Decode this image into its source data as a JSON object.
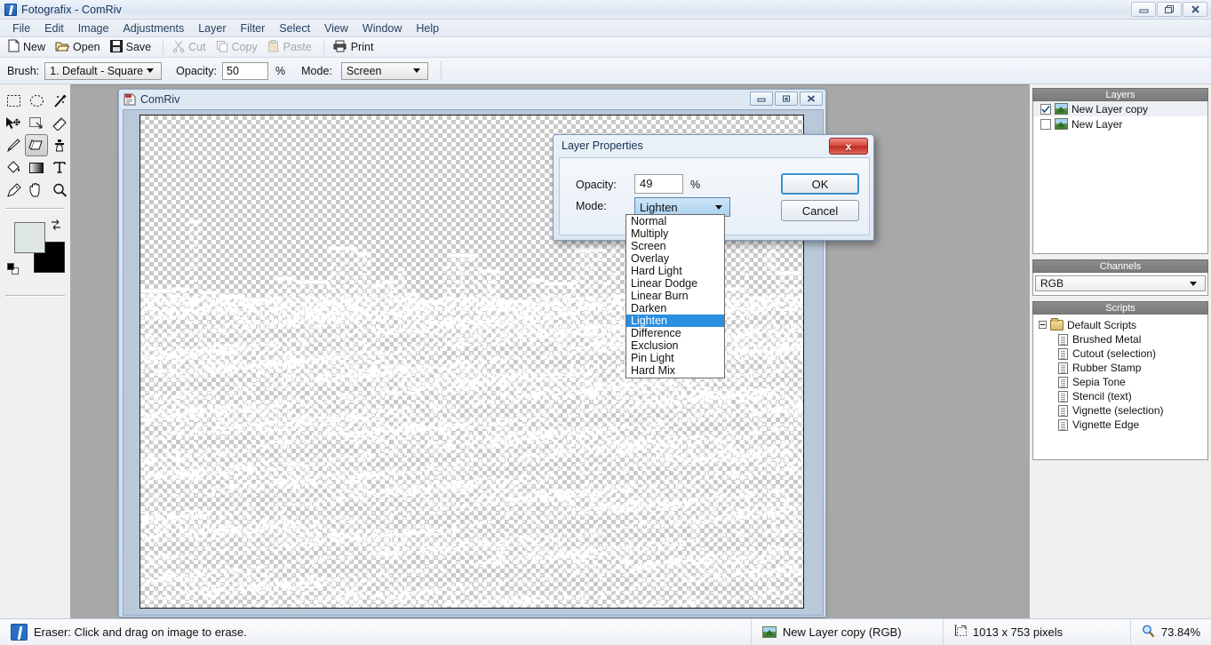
{
  "window": {
    "title": "Fotografix - ComRiv",
    "app_icon": "fotografix-icon",
    "buttons": [
      {
        "name": "minimize",
        "glyph": "minimize-icon"
      },
      {
        "name": "restore",
        "glyph": "restore-icon"
      },
      {
        "name": "close",
        "glyph": "close-icon"
      }
    ]
  },
  "menubar": {
    "items": [
      "File",
      "Edit",
      "Image",
      "Adjustments",
      "Layer",
      "Filter",
      "Select",
      "View",
      "Window",
      "Help"
    ]
  },
  "toolbar": {
    "buttons": [
      {
        "label": "New",
        "icon": "new-document-icon",
        "disabled": false
      },
      {
        "label": "Open",
        "icon": "open-folder-icon",
        "disabled": false
      },
      {
        "label": "Save",
        "icon": "save-disk-icon",
        "disabled": false
      },
      {
        "label": "Cut",
        "icon": "scissors-icon",
        "disabled": true
      },
      {
        "label": "Copy",
        "icon": "copy-icon",
        "disabled": true
      },
      {
        "label": "Paste",
        "icon": "paste-icon",
        "disabled": true
      },
      {
        "label": "Print",
        "icon": "printer-icon",
        "disabled": false
      }
    ]
  },
  "options_bar": {
    "brush_label": "Brush:",
    "brush_value": "1. Default - Square C",
    "opacity_label": "Opacity:",
    "opacity_value": "50",
    "percent_symbol": "%",
    "mode_label": "Mode:",
    "mode_value": "Screen"
  },
  "toolbox": {
    "tools": [
      {
        "name": "rectangular-marquee-tool",
        "active": false
      },
      {
        "name": "elliptical-marquee-tool",
        "active": false
      },
      {
        "name": "magic-wand-tool",
        "active": false
      },
      {
        "name": "move-tool",
        "active": false
      },
      {
        "name": "crop-tool",
        "active": false
      },
      {
        "name": "measure-tool",
        "active": false
      },
      {
        "name": "paintbrush-tool",
        "active": false
      },
      {
        "name": "eraser-tool",
        "active": true
      },
      {
        "name": "clone-stamp-tool",
        "active": false
      },
      {
        "name": "paint-bucket-tool",
        "active": false
      },
      {
        "name": "gradient-tool",
        "active": false
      },
      {
        "name": "text-tool",
        "active": false
      },
      {
        "name": "eyedropper-tool",
        "active": false
      },
      {
        "name": "hand-tool",
        "active": false
      },
      {
        "name": "zoom-tool",
        "active": false
      }
    ],
    "foreground_color": "#dfe6e6",
    "background_color": "#000000"
  },
  "document_window": {
    "title": "ComRiv",
    "buttons": [
      {
        "name": "minimize",
        "glyph": "minimize-icon"
      },
      {
        "name": "maximize",
        "glyph": "maximize-icon"
      },
      {
        "name": "close",
        "glyph": "close-icon"
      }
    ]
  },
  "dock": {
    "layers_panel": {
      "title": "Layers",
      "rows": [
        {
          "name": "New Layer copy",
          "visible": true,
          "selected": true
        },
        {
          "name": "New Layer",
          "visible": false,
          "selected": false
        }
      ]
    },
    "channels_panel": {
      "title": "Channels",
      "selected": "RGB"
    },
    "scripts_panel": {
      "title": "Scripts",
      "root": "Default Scripts",
      "items": [
        "Brushed Metal",
        "Cutout (selection)",
        "Rubber Stamp",
        "Sepia Tone",
        "Stencil (text)",
        "Vignette (selection)",
        "Vignette Edge"
      ]
    }
  },
  "dialog": {
    "title": "Layer Properties",
    "close_label": "x",
    "opacity_label": "Opacity:",
    "opacity_value": "49",
    "percent_symbol": "%",
    "mode_label": "Mode:",
    "mode_value": "Lighten",
    "ok_label": "OK",
    "cancel_label": "Cancel",
    "mode_options": [
      "Normal",
      "Multiply",
      "Screen",
      "Overlay",
      "Hard Light",
      "Linear Dodge",
      "Linear Burn",
      "Darken",
      "Lighten",
      "Difference",
      "Exclusion",
      "Pin Light",
      "Hard Mix"
    ],
    "selected_option": "Lighten",
    "highlight_color": "#2b8fe0"
  },
  "statusbar": {
    "hint_icon": "eraser-tool-icon",
    "hint": "Eraser: Click and drag on image to erase.",
    "layer_icon": "layer-thumbnail-icon",
    "layer": "New Layer copy (RGB)",
    "size_icon": "image-size-icon",
    "size": "1013 x 753 pixels",
    "zoom_icon": "magnifier-icon",
    "zoom": "73.84%"
  }
}
